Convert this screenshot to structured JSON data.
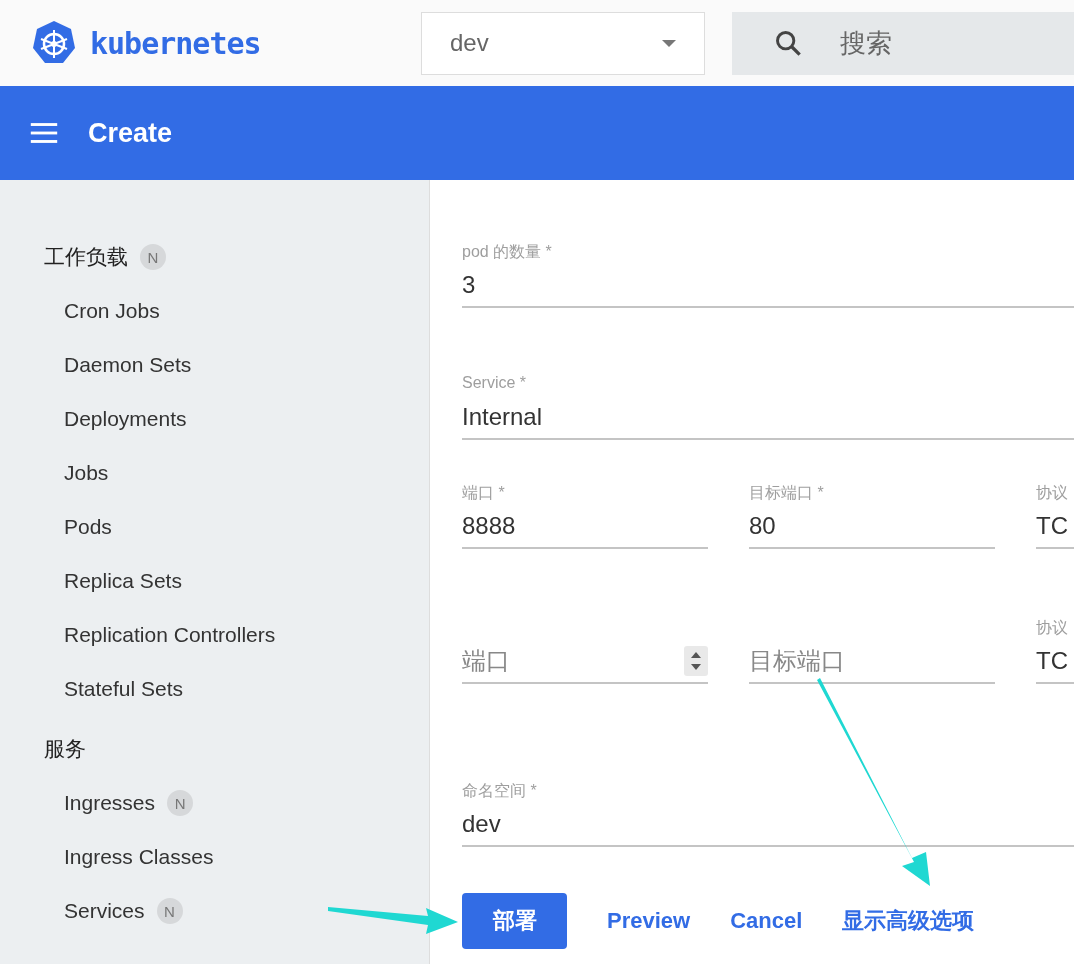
{
  "header": {
    "logo": "kubernetes",
    "namespace": "dev",
    "search": {
      "placeholder": "搜索"
    }
  },
  "toolbar": {
    "title": "Create"
  },
  "sidebar": {
    "sections": [
      {
        "title": "工作负载",
        "badge": "N",
        "items": [
          {
            "label": "Cron Jobs"
          },
          {
            "label": "Daemon Sets"
          },
          {
            "label": "Deployments"
          },
          {
            "label": "Jobs"
          },
          {
            "label": "Pods"
          },
          {
            "label": "Replica Sets"
          },
          {
            "label": "Replication Controllers"
          },
          {
            "label": "Stateful Sets"
          }
        ]
      },
      {
        "title": "服务",
        "items": [
          {
            "label": "Ingresses",
            "badge": "N"
          },
          {
            "label": "Ingress Classes"
          },
          {
            "label": "Services",
            "badge": "N"
          }
        ]
      }
    ]
  },
  "form": {
    "rows": [
      [
        {
          "label": "pod 的数量 *",
          "value": "3"
        }
      ],
      [
        {
          "label": "Service *",
          "value": "Internal"
        }
      ],
      [
        {
          "label": "端口 *",
          "value": "8888"
        },
        {
          "label": "目标端口 *",
          "value": "80"
        },
        {
          "label": "协议",
          "value": "TC"
        }
      ],
      [
        {
          "placeholder": "端口",
          "kind": "number"
        },
        {
          "placeholder": "目标端口"
        },
        {
          "label": "协议",
          "value": "TC"
        }
      ],
      [
        {
          "label": "命名空间 *",
          "value": "dev"
        }
      ]
    ]
  },
  "actions": [
    {
      "label": "部署",
      "kind": "primary"
    },
    {
      "label": "Preview",
      "kind": "link"
    },
    {
      "label": "Cancel",
      "kind": "link"
    },
    {
      "label": "显示高级选项",
      "kind": "link"
    }
  ]
}
